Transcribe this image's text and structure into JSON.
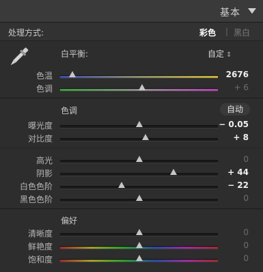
{
  "header": {
    "title": "基本"
  },
  "treatment": {
    "label": "处理方式:",
    "color": "彩色",
    "separator": "|",
    "bw": "黑白"
  },
  "white_balance": {
    "label": "白平衡:",
    "value": "自定",
    "arrows": "⇕"
  },
  "tone": {
    "title": "色调",
    "auto_label": "自动"
  },
  "presence": {
    "title": "偏好"
  },
  "sliders": {
    "temp": {
      "label": "色温",
      "value": "2676",
      "position": 0.08
    },
    "tint": {
      "label": "色调",
      "value": "+ 6",
      "position": 0.52
    },
    "exposure": {
      "label": "曝光度",
      "value": "− 0.05",
      "position": 0.5
    },
    "contrast": {
      "label": "对比度",
      "value": "+ 8",
      "position": 0.54
    },
    "highlights": {
      "label": "高光",
      "value": "0",
      "position": 0.5
    },
    "shadows": {
      "label": "阴影",
      "value": "+ 44",
      "position": 0.72
    },
    "whites": {
      "label": "白色色阶",
      "value": "− 22",
      "position": 0.39
    },
    "blacks": {
      "label": "黑色色阶",
      "value": "0",
      "position": 0.5
    },
    "clarity": {
      "label": "清晰度",
      "value": "0",
      "position": 0.5
    },
    "vibrance": {
      "label": "鲜艳度",
      "value": "0",
      "position": 0.5
    },
    "saturation": {
      "label": "饱和度",
      "value": "0",
      "position": 0.5
    }
  },
  "track_colors": {
    "temp": [
      "#3a4ea8",
      "#8a8a6a",
      "#c8b23a"
    ],
    "tint": [
      "#3c9c3c",
      "#8a8a8a",
      "#b040b0"
    ],
    "vibrance": [
      "#a02a2a",
      "#a0a02a",
      "#2aa02a",
      "#2a4aa0",
      "#a02aa0",
      "#a02a2a"
    ],
    "saturation": [
      "#a02a2a",
      "#a0a02a",
      "#2aa02a",
      "#2a4aa0",
      "#a02aa0",
      "#a02a2a"
    ]
  }
}
